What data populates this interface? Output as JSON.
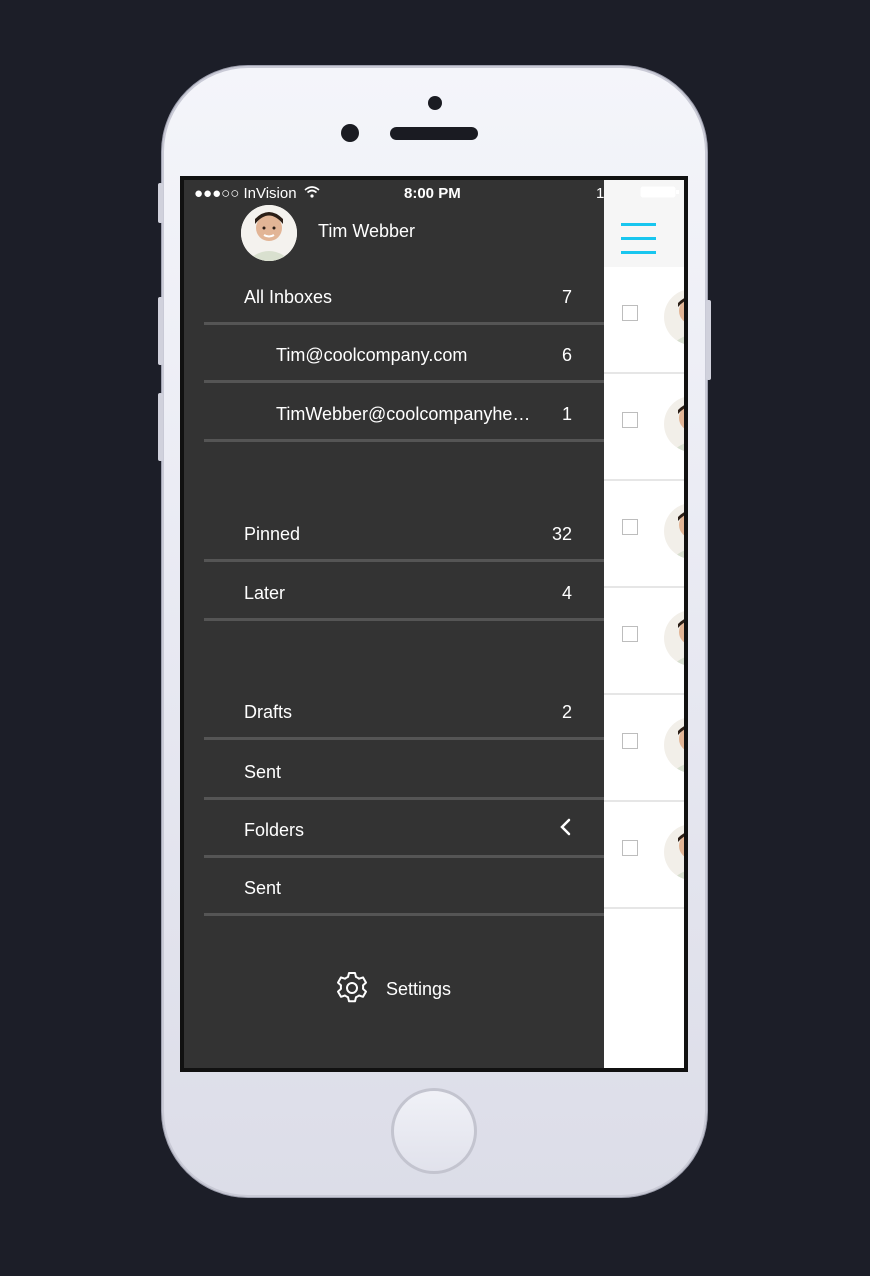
{
  "status_bar": {
    "carrier": "●●●○○ InVision",
    "time": "8:00 PM",
    "battery": "1"
  },
  "profile": {
    "name": "Tim Webber"
  },
  "drawer": {
    "items": [
      {
        "label": "All Inboxes",
        "count": "7"
      },
      {
        "label": "Tim@coolcompany.com",
        "count": "6"
      },
      {
        "label": "TimWebber@coolcompanyhe…",
        "count": "1"
      },
      {
        "label": "Pinned",
        "count": "32"
      },
      {
        "label": "Later",
        "count": "4"
      },
      {
        "label": "Drafts",
        "count": "2"
      },
      {
        "label": "Sent",
        "count": ""
      },
      {
        "label": "Folders",
        "count": ""
      },
      {
        "label": "Sent",
        "count": ""
      }
    ],
    "settings_label": "Settings"
  },
  "colors": {
    "drawer_bg": "#333333",
    "accent": "#18c6ef",
    "divider": "#555555"
  }
}
